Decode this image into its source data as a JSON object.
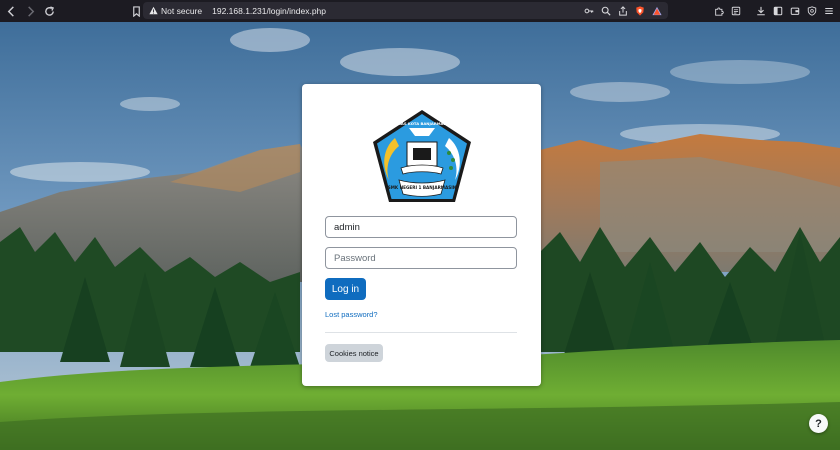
{
  "browser": {
    "security_label": "Not secure",
    "url": "192.168.1.231/login/index.php"
  },
  "login": {
    "username_value": "admin",
    "password_placeholder": "Password",
    "login_label": "Log in",
    "lost_password_label": "Lost password?",
    "cookies_label": "Cookies notice"
  },
  "logo": {
    "top_text": "DINAS KOTA BANJARMASIN",
    "bottom_text": "SMK NEGERI 1 BANJARMASIN"
  },
  "help": {
    "label": "?"
  },
  "colors": {
    "primary": "#0f6cbf",
    "secondary": "#ced4da",
    "chrome": "#1c1b22",
    "urlbar": "#2b2a33"
  },
  "icons": [
    "back-icon",
    "forward-icon",
    "reload-icon",
    "bookmark-icon",
    "warning-icon",
    "key-icon",
    "zoom-icon",
    "share-icon",
    "brave-shield-icon",
    "brave-rewards-icon",
    "extensions-icon",
    "reader-icon",
    "downloads-icon",
    "sidebar-icon",
    "wallet-icon",
    "vpn-icon",
    "menu-icon",
    "help-icon"
  ]
}
